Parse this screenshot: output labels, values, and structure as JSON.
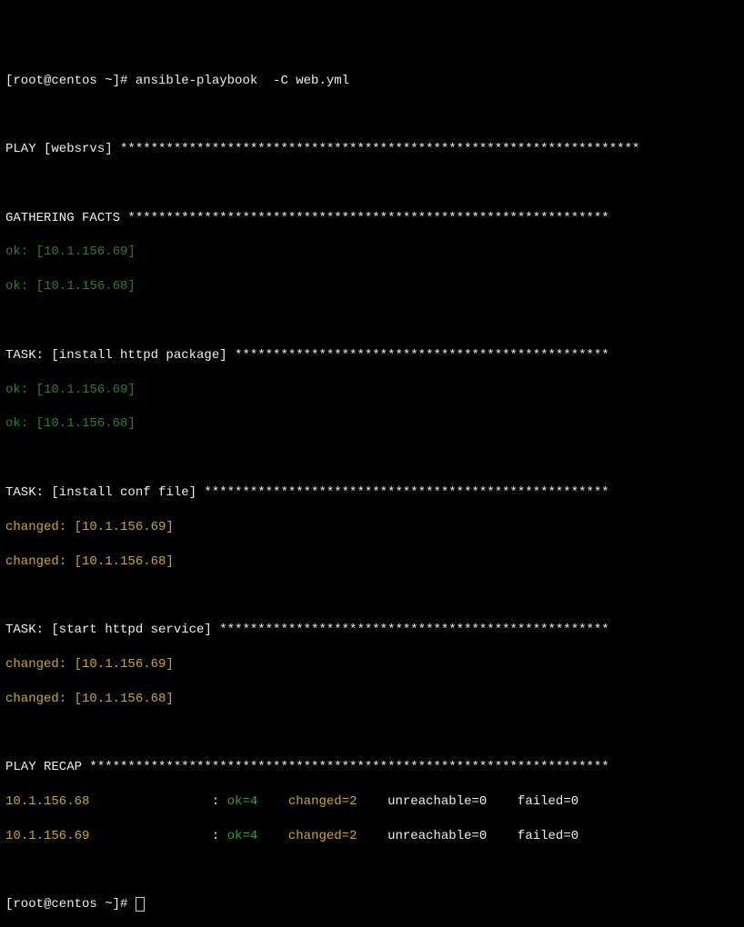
{
  "prompt1": "[root@centos ~]# ansible-playbook  -C web.yml",
  "play_header": "PLAY [websrvs] ******************************************************************** ",
  "gathering_header": "GATHERING FACTS *************************************************************** ",
  "ok_69": "ok: [10.1.156.69]",
  "ok_68": "ok: [10.1.156.68]",
  "task1_header": "TASK: [install httpd package] ************************************************* ",
  "task2_header": "TASK: [install conf file] ***************************************************** ",
  "changed_69": "changed: [10.1.156.69]",
  "changed_68": "changed: [10.1.156.68]",
  "task3_header": "TASK: [start httpd service] *************************************************** ",
  "recap_header": "PLAY RECAP ******************************************************************** ",
  "recap": {
    "host68": "10.1.156.68                ",
    "host69": "10.1.156.69                ",
    "colon": ": ",
    "ok": "ok=4    ",
    "changed": "changed=2    ",
    "unreachable": "unreachable=0    ",
    "failed": "failed=0   "
  },
  "prompt2": "[root@centos ~]# "
}
